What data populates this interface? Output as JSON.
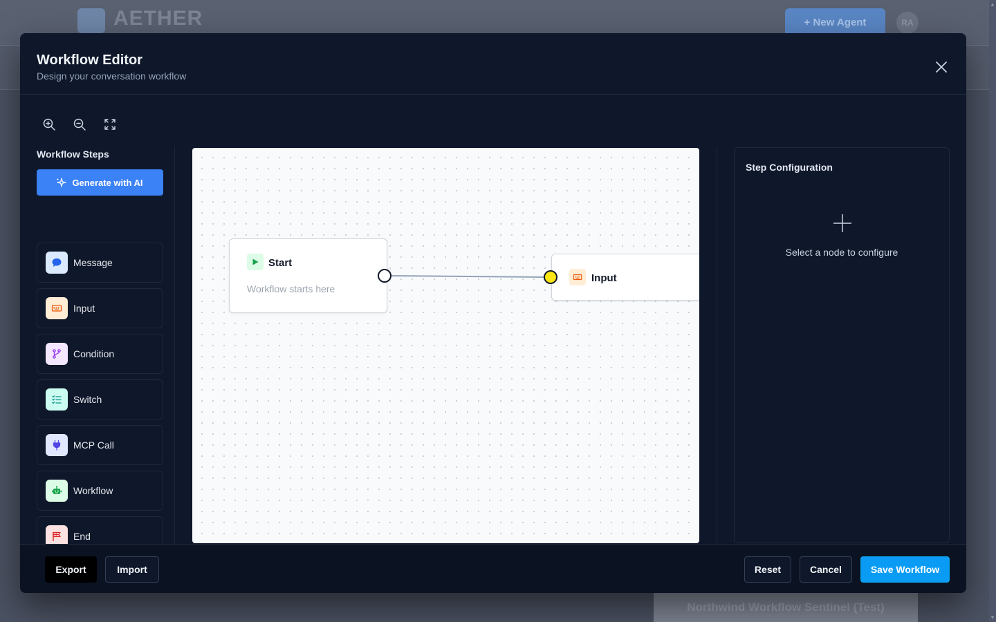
{
  "background": {
    "brand": "AETHER",
    "new_agent_label": "+ New Agent",
    "avatar_initials": "RA",
    "card_title": "Northwind Workflow Sentinel (Test)"
  },
  "modal": {
    "title": "Workflow Editor",
    "subtitle": "Design your conversation workflow"
  },
  "toolbar": {
    "icons": [
      "zoom-in-icon",
      "zoom-out-icon",
      "fit-view-icon"
    ]
  },
  "steps": {
    "title": "Workflow Steps",
    "generate_label": "Generate with AI",
    "items": [
      {
        "label": "Message",
        "icon": "message-icon",
        "color": "#2563eb",
        "bg": "#dbeafe"
      },
      {
        "label": "Input",
        "icon": "keyboard-icon",
        "color": "#ea580c",
        "bg": "#ffedd5"
      },
      {
        "label": "Condition",
        "icon": "branch-icon",
        "color": "#9333ea",
        "bg": "#f3e8ff"
      },
      {
        "label": "Switch",
        "icon": "list-check-icon",
        "color": "#0d9488",
        "bg": "#ccfbf1"
      },
      {
        "label": "MCP Call",
        "icon": "plug-icon",
        "color": "#4f46e5",
        "bg": "#e0e7ff"
      },
      {
        "label": "Workflow",
        "icon": "robot-icon",
        "color": "#16a34a",
        "bg": "#dcfce7"
      },
      {
        "label": "End",
        "icon": "flag-icon",
        "color": "#dc2626",
        "bg": "#fee2e2"
      }
    ]
  },
  "canvas": {
    "nodes": {
      "start": {
        "title": "Start",
        "description": "Workflow starts here"
      },
      "input": {
        "title": "Input"
      }
    }
  },
  "config": {
    "title": "Step Configuration",
    "empty_text": "Select a node to configure"
  },
  "footer": {
    "export_label": "Export",
    "import_label": "Import",
    "reset_label": "Reset",
    "cancel_label": "Cancel",
    "save_label": "Save Workflow"
  },
  "colors": {
    "primary": "#3b82f6",
    "save": "#0a9cf5",
    "modal_bg": "#0f172a",
    "handle_active": "#fde614"
  }
}
